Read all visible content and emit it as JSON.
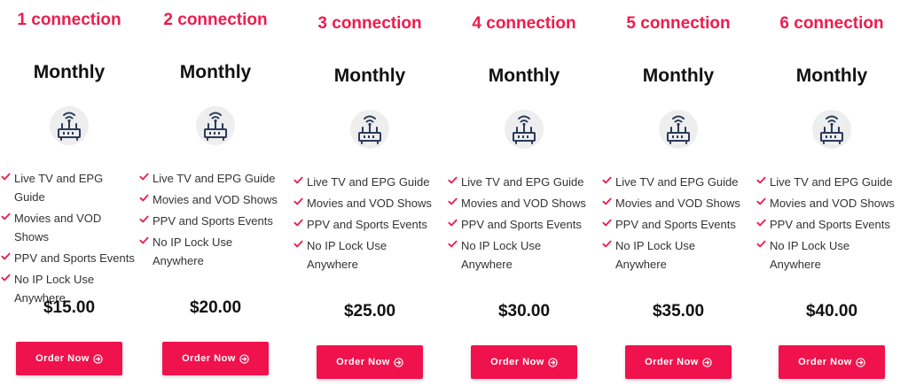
{
  "plans": [
    {
      "title": "1 connection",
      "period": "Monthly",
      "price": "$15.00",
      "cta": "Order Now"
    },
    {
      "title": "2 connection",
      "period": "Monthly",
      "price": "$20.00",
      "cta": "Order Now"
    },
    {
      "title": "3 connection",
      "period": "Monthly",
      "price": "$25.00",
      "cta": "Order Now"
    },
    {
      "title": "4 connection",
      "period": "Monthly",
      "price": "$30.00",
      "cta": "Order Now"
    },
    {
      "title": "5 connection",
      "period": "Monthly",
      "price": "$35.00",
      "cta": "Order Now"
    },
    {
      "title": "6 connection",
      "period": "Monthly",
      "price": "$40.00",
      "cta": "Order Now"
    }
  ],
  "features": [
    "Live TV and EPG Guide",
    "Movies and VOD Shows",
    "PPV and Sports Events",
    "No IP Lock Use Anywhere"
  ],
  "plan_icon": "router-wifi-icon",
  "check_icon": "check-icon",
  "cta_icon": "arrow-circle-right-icon",
  "colors": {
    "accent": "#ee1c4e",
    "button": "#f0124c",
    "icon": "#2a3b5a",
    "background": "#f4f1f2"
  }
}
